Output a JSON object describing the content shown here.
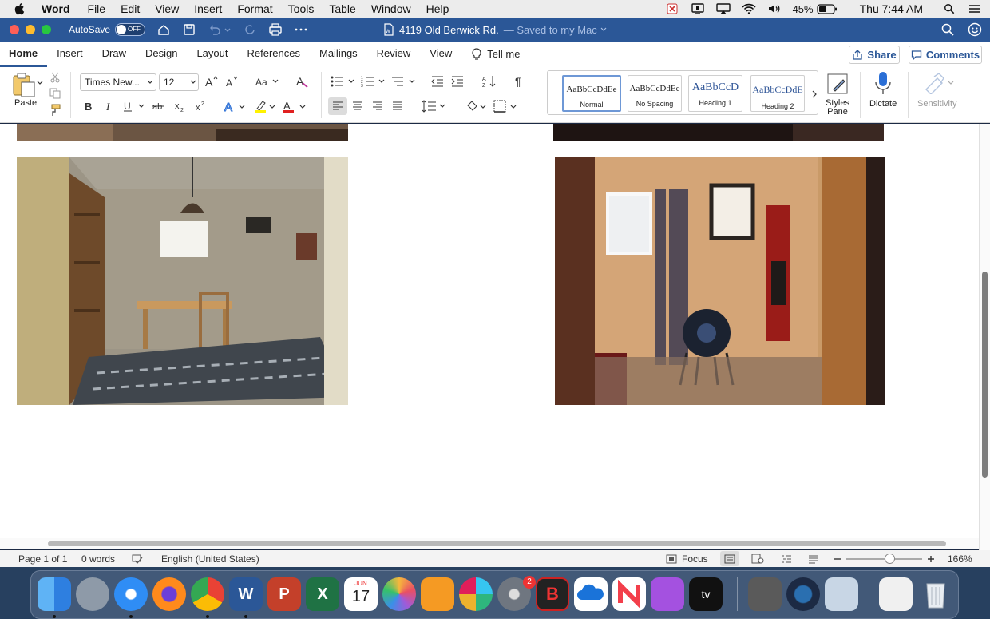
{
  "menubar": {
    "app_name": "Word",
    "items": [
      "File",
      "Edit",
      "View",
      "Insert",
      "Format",
      "Tools",
      "Table",
      "Window",
      "Help"
    ],
    "battery": "45%",
    "clock": "Thu 7:44 AM"
  },
  "titlebar": {
    "autosave_label": "AutoSave",
    "autosave_state": "OFF",
    "doc_title": "4119 Old Berwick Rd.",
    "saved_status": "— Saved to my Mac"
  },
  "ribbon_tabs": {
    "tabs": [
      "Home",
      "Insert",
      "Draw",
      "Design",
      "Layout",
      "References",
      "Mailings",
      "Review",
      "View"
    ],
    "tell_me": "Tell me",
    "share": "Share",
    "comments": "Comments"
  },
  "ribbon": {
    "paste_label": "Paste",
    "font_name": "Times New...",
    "font_size": "12",
    "styles": [
      {
        "sample": "AaBbCcDdEe",
        "name": "Normal"
      },
      {
        "sample": "AaBbCcDdEe",
        "name": "No Spacing"
      },
      {
        "sample": "AaBbCcD",
        "name": "Heading 1"
      },
      {
        "sample": "AaBbCcDdE",
        "name": "Heading 2"
      }
    ],
    "styles_pane_label": "Styles Pane",
    "dictate_label": "Dictate",
    "sensitivity_label": "Sensitivity"
  },
  "statusbar": {
    "page": "Page 1 of 1",
    "words": "0 words",
    "language": "English (United States)",
    "focus": "Focus",
    "zoom": "166%"
  },
  "colors": {
    "word_blue": "#2b5797",
    "accent_link": "#2b5797"
  },
  "dock": {
    "apps": [
      "finder-icon",
      "launchpad-icon",
      "safari-icon",
      "firefox-icon",
      "chrome-icon",
      "word-icon",
      "powerpoint-icon",
      "excel-icon",
      "calendar-icon",
      "photos-icon",
      "pages-icon",
      "slack-icon",
      "system-preferences-icon",
      "bbedit-icon",
      "onedrive-icon",
      "news-icon",
      "podcasts-icon",
      "apple-tv-icon",
      "calculator-icon",
      "quicktime-icon",
      "preview-icon",
      "chrome-window-icon",
      "trash-icon"
    ],
    "calendar_month": "JUN",
    "calendar_day": "17",
    "badge_count": "2"
  }
}
